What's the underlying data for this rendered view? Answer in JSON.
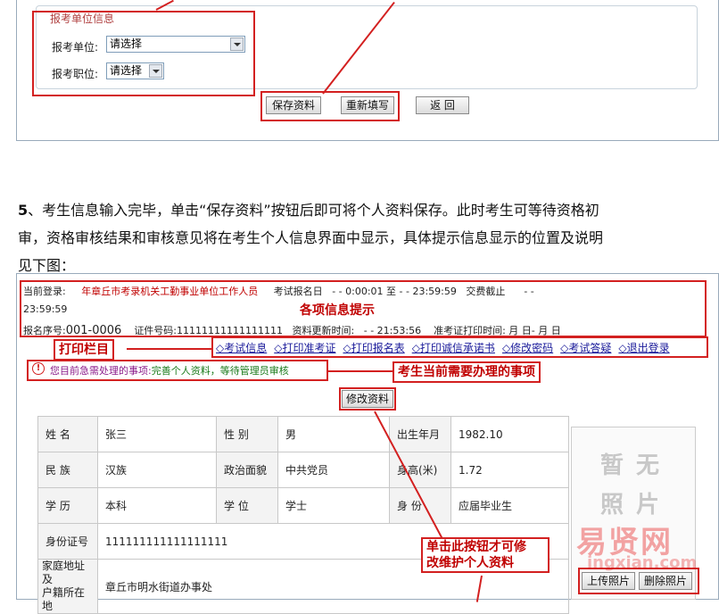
{
  "top_form": {
    "legend": "报考单位信息",
    "unit_label": "报考单位:",
    "unit_value": "请选择",
    "position_label": "报考职位:",
    "position_value": "请选择",
    "save_label": "保存资料",
    "reset_label": "重新填写",
    "back_label": "返  回"
  },
  "paragraph": {
    "number": "5",
    "line1": "、考生信息输入完毕，单击“保存资料”按钮后即可将个人资料保存。此时考生可等待资格初",
    "line2": "审，资格审核结果和审核意见将在考生个人信息界面中显示，具体提示信息显示的位置及说明",
    "line3": "见下图："
  },
  "info_bar": {
    "login_label": "当前登录:",
    "login_value": "年章丘市考录机关工勤事业单位工作人员",
    "exam_label": "考试报名日",
    "exam_value": "- -  0:00:01 至       - -      23:59:59",
    "deadline_label": "交费截止",
    "deadline_value": "- -",
    "time2": "23:59:59",
    "reg_label": "报名序号:",
    "reg_value": "001-0006",
    "id_label": "证件号码:",
    "id_value": "11111111111111111",
    "update_label": "资料更新时间:",
    "update_value": "- -   21:53:56",
    "print_label": "准考证打印时间:",
    "print_value": "月   日-  月   日"
  },
  "annotations": {
    "info_hint": "各项信息提示",
    "print_bar": "打印栏目",
    "todo": "考生当前需要办理的事项",
    "edit_hint_1": "单击此按钮才可修",
    "edit_hint_2": "改维护个人资料"
  },
  "nav_links": [
    "◇考试信息",
    "◇打印准考证",
    "◇打印报名表",
    "◇打印诚信承诺书",
    "◇修改密码",
    "◇考试答疑",
    "◇退出登录"
  ],
  "notice": {
    "prefix": "您目前急需处理的事项:",
    "text": "完善个人资料，等待管理员审核"
  },
  "edit_button": "修改资料",
  "profile": {
    "name_label": "姓    名",
    "name": "张三",
    "gender_label": "性    别",
    "gender": "男",
    "birth_label": "出生年月",
    "birth": "1982.10",
    "ethnic_label": "民    族",
    "ethnic": "汉族",
    "politics_label": "政治面貌",
    "politics": "中共党员",
    "height_label": "身高(米)",
    "height": "1.72",
    "edu_label": "学    历",
    "edu": "本科",
    "degree_label": "学    位",
    "degree": "学士",
    "status_label": "身    份",
    "status": "应届毕业生",
    "idno_label": "身份证号",
    "idno": "111111111111111111",
    "address_label_1": "家庭地址及",
    "address_label_2": "户籍所在地",
    "address": "章丘市明水街道办事处"
  },
  "photo": {
    "line1": "暂无",
    "line2": "照片",
    "upload": "上传照片",
    "delete": "删除照片"
  },
  "watermark": {
    "main": "易贤网",
    "sub": "ingxian.com"
  },
  "colors": {
    "annotation_red": "#d32020",
    "link_blue": "#1a1a9a",
    "notice_green": "#1a7a1a"
  }
}
